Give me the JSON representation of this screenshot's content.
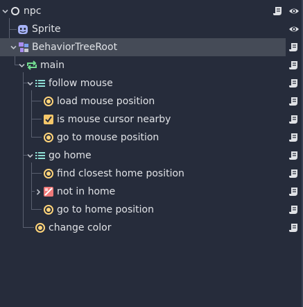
{
  "scene_tree": {
    "nodes": [
      {
        "label": "npc",
        "icon": "node-circle-icon",
        "expanded": true,
        "buttons": [
          "script-icon",
          "visibility-eye-icon"
        ]
      },
      {
        "label": "Sprite",
        "icon": "sprite-icon",
        "buttons": [
          "visibility-eye-icon"
        ]
      },
      {
        "label": "BehaviorTreeRoot",
        "icon": "behavior-tree-root-icon",
        "expanded": true,
        "selected": true,
        "buttons": [
          "script-icon"
        ]
      },
      {
        "label": "main",
        "icon": "repeat-icon",
        "expanded": true,
        "buttons": [
          "script-icon"
        ]
      },
      {
        "label": "follow mouse",
        "icon": "sequence-icon",
        "expanded": true,
        "buttons": [
          "script-icon"
        ]
      },
      {
        "label": "load mouse position",
        "icon": "action-icon",
        "buttons": [
          "script-icon"
        ]
      },
      {
        "label": "is mouse cursor nearby",
        "icon": "condition-check-icon",
        "buttons": [
          "script-icon"
        ]
      },
      {
        "label": "go to mouse position",
        "icon": "action-icon",
        "buttons": [
          "script-icon"
        ]
      },
      {
        "label": "go home",
        "icon": "sequence-icon",
        "expanded": true,
        "buttons": [
          "script-icon"
        ]
      },
      {
        "label": "find closest home position",
        "icon": "action-icon",
        "buttons": [
          "script-icon"
        ]
      },
      {
        "label": "not in home",
        "icon": "inverter-icon",
        "expanded": false,
        "buttons": [
          "script-icon"
        ]
      },
      {
        "label": "go to home position",
        "icon": "action-icon",
        "buttons": [
          "script-icon"
        ]
      },
      {
        "label": "change color",
        "icon": "action-icon",
        "buttons": [
          "script-icon"
        ]
      }
    ]
  },
  "colors": {
    "background": "#262c3b",
    "selected_row": "#454b57",
    "text": "#e0e2e6",
    "action_icon": "#ffd47a",
    "condition_icon": "#f5c76a",
    "inverter_icon": "#f07a7a",
    "repeat_icon": "#73de91",
    "sequence_icon": "#8ee0d6",
    "root_icon_purple": "#a98ef0",
    "sprite_icon": "#a7b3f7"
  }
}
